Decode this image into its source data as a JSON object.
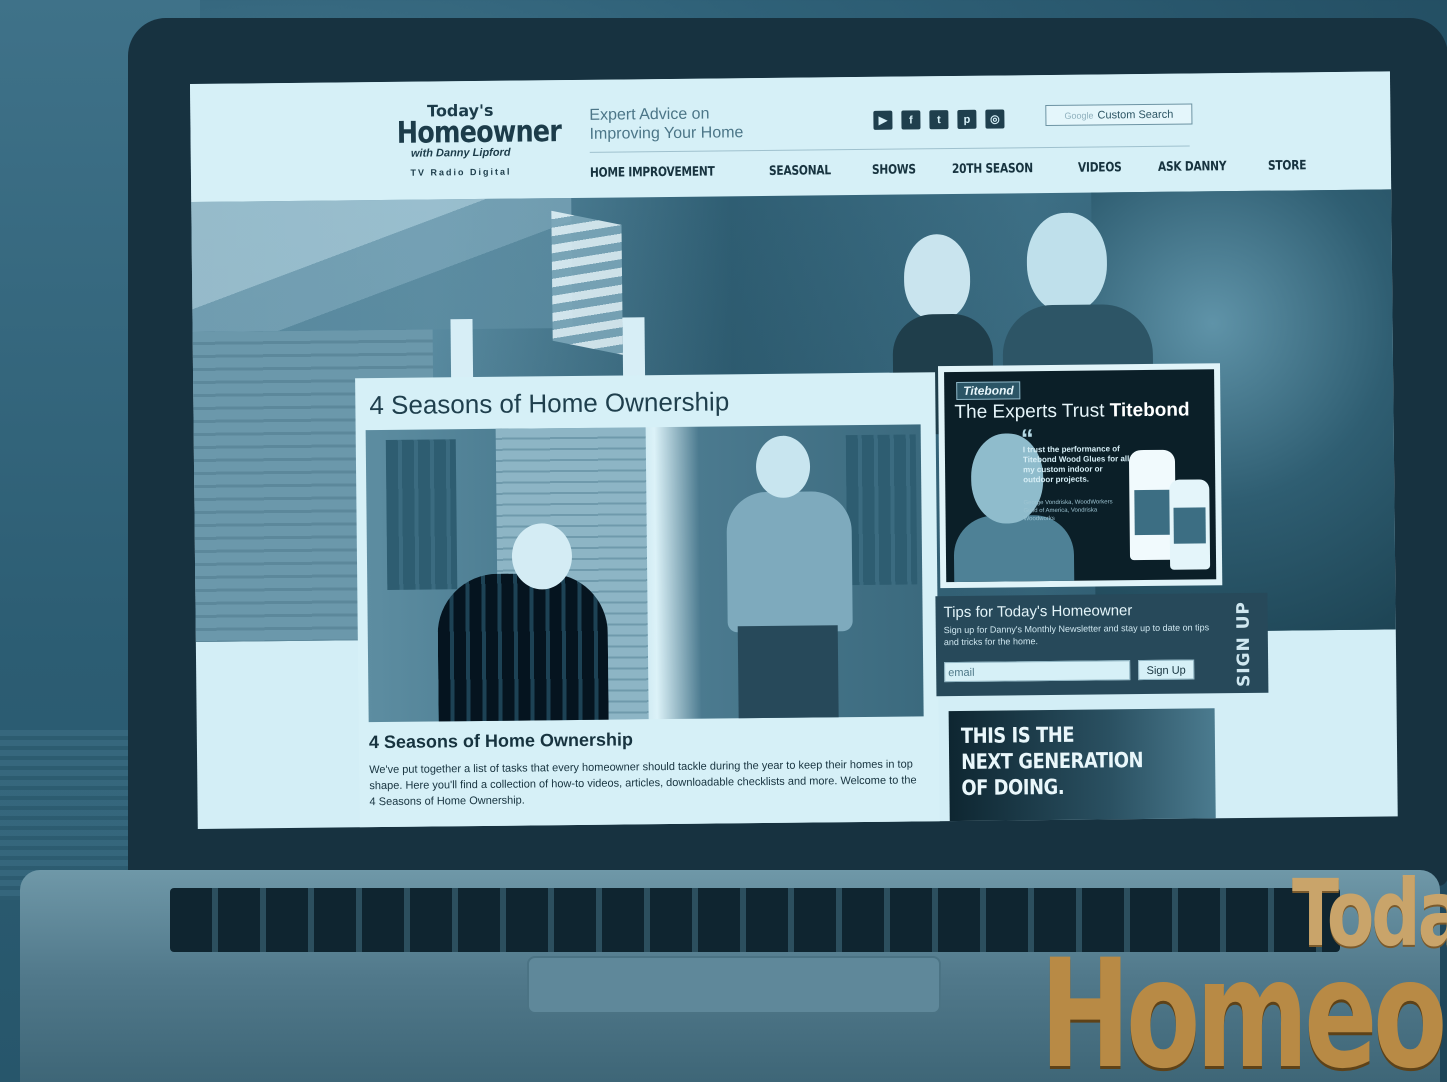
{
  "logo": {
    "top": "Today's",
    "main": "Homeowner",
    "sub": "with Danny Lipford",
    "media": "TV  Radio  Digital"
  },
  "header": {
    "tagline_line1": "Expert Advice on",
    "tagline_line2": "Improving Your Home",
    "social": [
      {
        "icon": "youtube-icon",
        "glyph": "▶"
      },
      {
        "icon": "facebook-icon",
        "glyph": "f"
      },
      {
        "icon": "twitter-icon",
        "glyph": "t"
      },
      {
        "icon": "pinterest-icon",
        "glyph": "p"
      },
      {
        "icon": "instagram-icon",
        "glyph": "◎"
      }
    ],
    "search_brand": "Google",
    "search_label": "Custom Search"
  },
  "nav": {
    "items": [
      "HOME IMPROVEMENT",
      "SEASONAL",
      "SHOWS",
      "20TH SEASON",
      "VIDEOS",
      "ASK DANNY",
      "STORE"
    ]
  },
  "feature": {
    "title": "4 Seasons of Home Ownership",
    "subtitle": "4 Seasons of Home Ownership",
    "body": "We've put together a list of tasks that every homeowner should tackle during the year to keep their homes in top shape. Here you'll find a collection of how-to videos, articles, downloadable checklists and more. Welcome to the 4 Seasons of Home Ownership."
  },
  "ad_titebond": {
    "brand": "Titebond",
    "headline_pre": "The Experts Trust",
    "headline_brand": "Titebond",
    "quote": "I trust the performance of Titebond Wood Glues for all my custom indoor or outdoor projects.",
    "quote_author": "George Vondriska, WoodWorkers Guild of America, Vondriska Woodworks"
  },
  "newsletter": {
    "title": "Tips for Today's Homeowner",
    "description": "Sign up for Danny's Monthly Newsletter and stay up to date on tips and tricks for the home.",
    "email_placeholder": "email",
    "button_label": "Sign Up",
    "side_label": "SIGN UP"
  },
  "ad_nextgen": {
    "line1": "THIS IS THE",
    "line2": "NEXT GENERATION",
    "line3": "OF DOING."
  },
  "corner_logo": {
    "line1": "Toda",
    "line2": "Homeo"
  },
  "colors": {
    "tint": "#2f6178",
    "screen_bg": "#d6f0f7",
    "gold": "#b88a45"
  }
}
